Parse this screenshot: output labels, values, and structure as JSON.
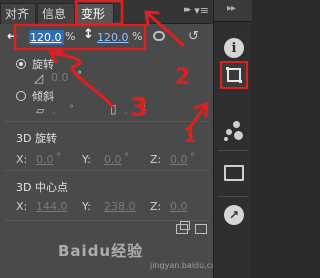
{
  "tabs": [
    {
      "label": "对齐",
      "active": false
    },
    {
      "label": "信息",
      "active": false
    },
    {
      "label": "变形",
      "active": true
    }
  ],
  "tab_menu_glyph": "▸▸",
  "tab_menu2_glyph": "▾≡",
  "scale": {
    "width_value": "120.0",
    "height_value": "120.0",
    "unit": "%"
  },
  "rotate": {
    "label": "旋转",
    "value": "0.0",
    "unit": "°",
    "checked": true
  },
  "skew": {
    "label": "倾斜",
    "h_value": "-",
    "v_value": "-",
    "unit": "°",
    "checked": false
  },
  "rotation3d": {
    "title": "3D 旋转",
    "x_label": "X:",
    "x_value": "0.0",
    "y_label": "Y:",
    "y_value": "0.0",
    "z_label": "Z:",
    "z_value": "0.0",
    "unit": "°"
  },
  "center3d": {
    "title": "3D 中心点",
    "x_label": "X:",
    "x_value": "144.0",
    "y_label": "Y:",
    "y_value": "238.0",
    "z_label": "Z:",
    "z_value": "0.0"
  },
  "annotations": {
    "label1": "1",
    "label2": "2",
    "label3": "3"
  },
  "watermark": {
    "main": "Baidu经验",
    "sub": "jingyan.baidu.com"
  },
  "colors": {
    "annotation": "#e02020",
    "accent_field": "#2f6db0",
    "panel": "#4a4a4a"
  },
  "dock_icons": [
    "info-icon",
    "transform-icon",
    "color-swatches-icon",
    "library-icon",
    "motion-icon"
  ]
}
